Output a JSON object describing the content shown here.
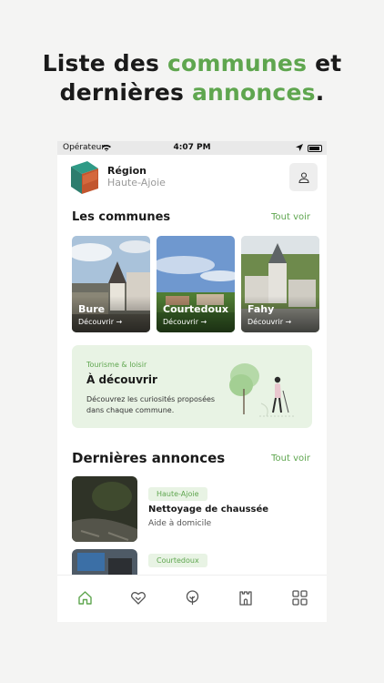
{
  "headline": {
    "part1": "Liste des ",
    "accent1": "communes",
    "part2": " et",
    "part3": "dernières ",
    "accent2": "annonces",
    "part4": "."
  },
  "statusbar": {
    "carrier": "Opérateur",
    "time": "4:07 PM"
  },
  "header": {
    "label": "Région",
    "name": "Haute-Ajoie"
  },
  "communes": {
    "title": "Les communes",
    "see_all": "Tout voir",
    "items": [
      {
        "name": "Bure",
        "action": "Découvrir →"
      },
      {
        "name": "Courtedoux",
        "action": "Découvrir →"
      },
      {
        "name": "Fahy",
        "action": "Découvrir →"
      }
    ]
  },
  "promo": {
    "category": "Tourisme & loisir",
    "title": "À découvrir",
    "description": "Découvrez les curiosités proposées dans chaque commune."
  },
  "annonces": {
    "title": "Dernières annonces",
    "see_all": "Tout voir",
    "items": [
      {
        "tag": "Haute-Ajoie",
        "title": "Nettoyage de chaussée",
        "subtitle": "Aide à domicile"
      },
      {
        "tag": "Courtedoux",
        "title": "",
        "subtitle": ""
      }
    ]
  },
  "tabbar": {
    "icons": [
      "home-icon",
      "handshake-icon",
      "tree-icon",
      "castle-icon",
      "grid-icon"
    ]
  },
  "colors": {
    "accent": "#5fa64f",
    "tint": "#e8f3e4"
  }
}
